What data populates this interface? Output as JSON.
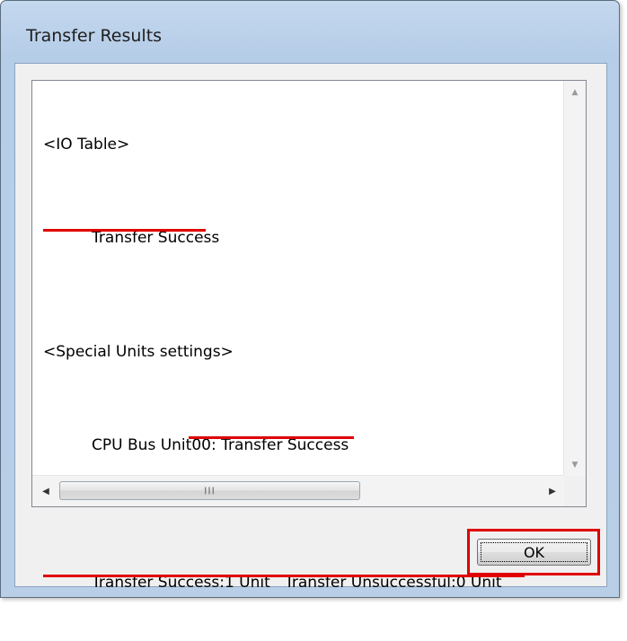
{
  "window": {
    "title": "Transfer Results"
  },
  "results": {
    "io_table_header": "<IO Table>",
    "io_table_status": "Transfer Success",
    "special_units_header": "<Special Units settings>",
    "cpu_bus_label": "CPU Bus Unit00: ",
    "cpu_bus_status": "Transfer Success",
    "summary": "Transfer Success:1 Unit   Transfer Unsuccessful:0 Unit"
  },
  "scroll": {
    "up_arrow": "▲",
    "down_arrow": "▼",
    "left_arrow": "◀",
    "right_arrow": "▶",
    "grip": "III"
  },
  "buttons": {
    "ok_label": "OK"
  },
  "colors": {
    "highlight": "#e00000",
    "window_frame": "#b9cfe8"
  }
}
